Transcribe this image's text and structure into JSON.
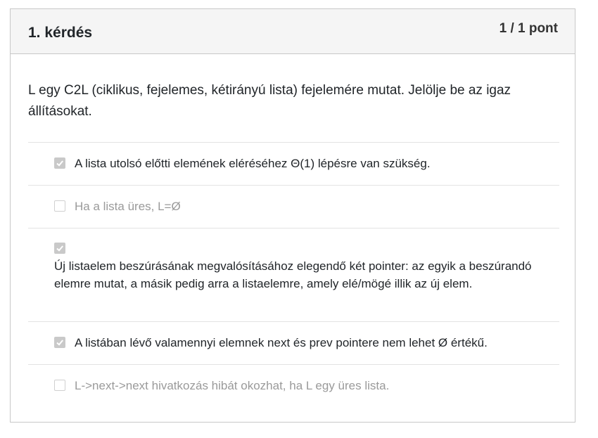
{
  "question": {
    "title": "1. kérdés",
    "score": "1 / 1 pont",
    "text": "L egy C2L (ciklikus, fejelemes, kétirányú lista) fejelemére mutat. Jelölje be az igaz állításokat."
  },
  "options": [
    {
      "label": "A lista utolsó előtti elemének eléréséhez Θ(1) lépésre van szükség.",
      "checked": true
    },
    {
      "label": "Ha a lista üres, L=Ø",
      "checked": false
    },
    {
      "label": "Új listaelem beszúrásának megvalósításához elegendő  két pointer: az egyik a beszúrandó elemre mutat, a másik pedig arra a listaelemre, amely elé/mögé illik az új elem.",
      "checked": true
    },
    {
      "label": "A listában lévő valamennyi elemnek next és prev pointere nem lehet Ø értékű.",
      "checked": true
    },
    {
      "label": "L->next->next hivatkozás hibát okozhat, ha L egy üres lista.",
      "checked": false
    }
  ]
}
